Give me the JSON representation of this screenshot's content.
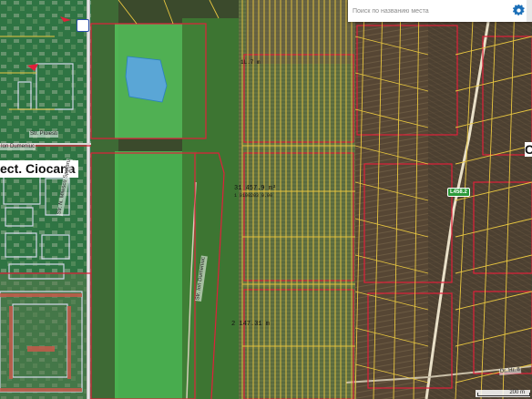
{
  "search": {
    "placeholder": "Поиск по названию места"
  },
  "labels": {
    "district": "ect. Ciocana",
    "district_right": "C",
    "road_badge": "L458.2",
    "plot_area_1": "31 457.9 m²",
    "plot_code_1": "1 0100203 0.00",
    "plot_area_2": "2 147.31 m",
    "top_small": "1L.7 m",
    "mid_small": "...",
    "streets": {
      "vertical_1": "Str. N. Milescu Spataru",
      "vertical_2": "Str. Ion Dumeniuc",
      "top_left": "Str. Ploiesti",
      "left_small": "Ion Dumeniuc",
      "bottom_right": "Dr. Hr. 8"
    }
  },
  "scale": {
    "label": "200 m"
  },
  "icons": {
    "settings": "gear-icon",
    "marker": "map-marker-icon"
  },
  "colors": {
    "parcel_border": "#e8c640",
    "zone_border": "#e0203a",
    "park": "#4cbf55",
    "water": "#5aa6d6",
    "field": "#5b4a36"
  }
}
